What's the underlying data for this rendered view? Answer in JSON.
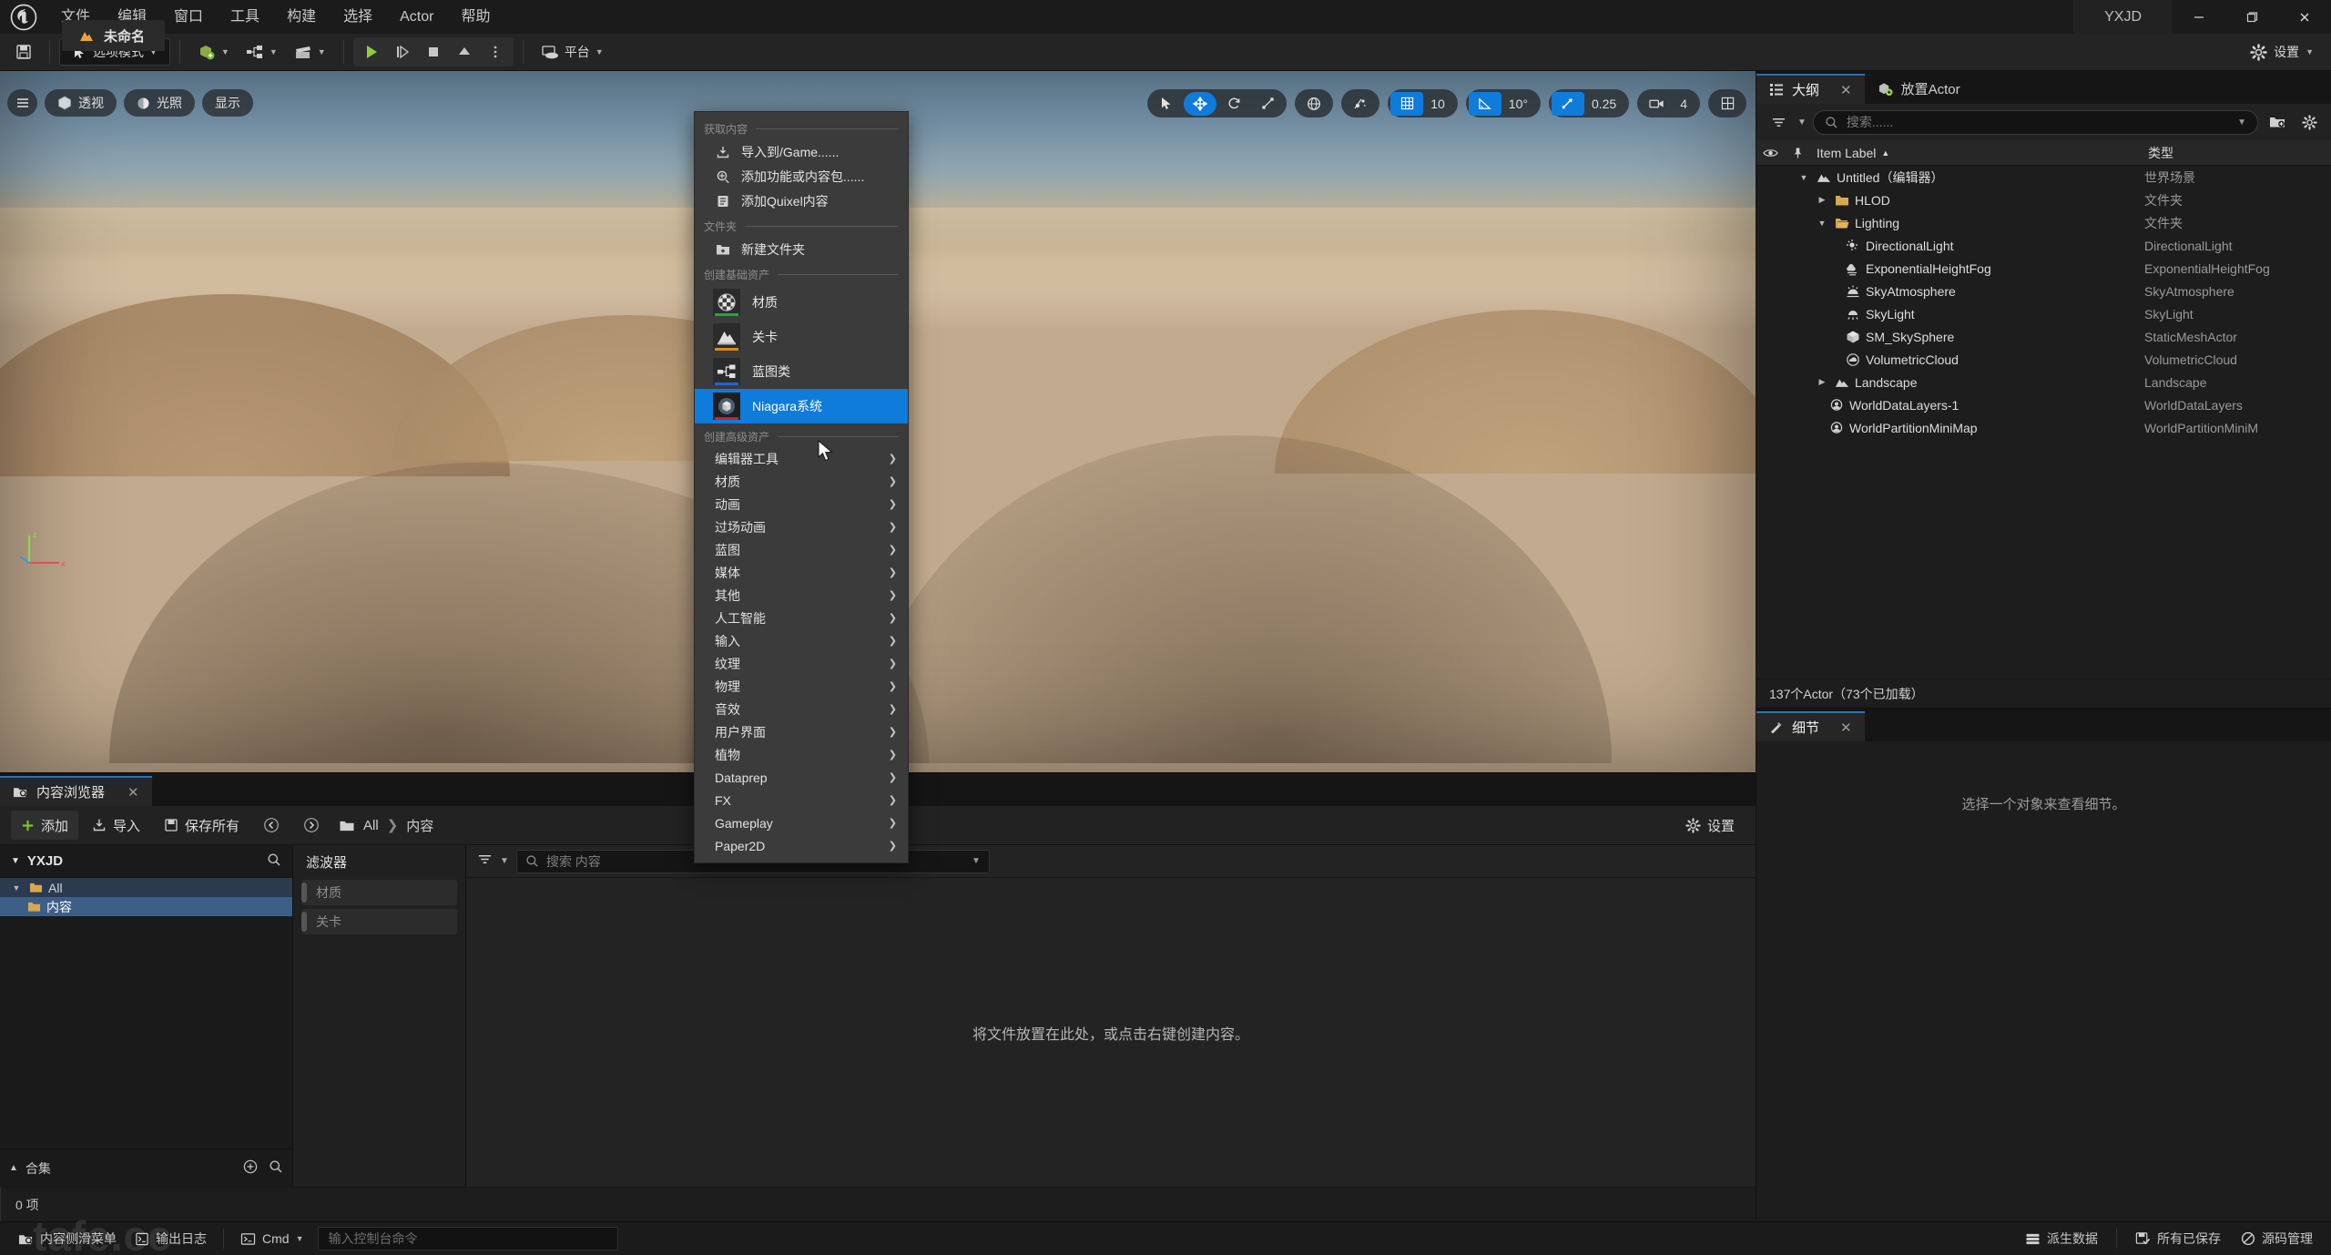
{
  "titlebar": {
    "menu_items": [
      "文件",
      "编辑",
      "窗口",
      "工具",
      "构建",
      "选择",
      "Actor",
      "帮助"
    ],
    "project_tab": "未命名",
    "window_title": "YXJD",
    "minimize": "—",
    "maximize": "❐",
    "close": "✕"
  },
  "toolbar": {
    "save_tip": "保存",
    "mode_label": "选项模式",
    "platform_label": "平台",
    "settings_label": "设置"
  },
  "viewport": {
    "menu_icon": "☰",
    "perspective": "透视",
    "lighting": "光照",
    "show": "显示",
    "grid_snap_value": "10",
    "angle_snap_value": "10°",
    "scale_snap_value": "0.25",
    "camera_speed_value": "4"
  },
  "context_menu": {
    "section_get_content": "获取内容",
    "section_folder": "文件夹",
    "section_basic_assets": "创建基础资产",
    "section_advanced_assets": "创建高级资产",
    "get_content_items": [
      {
        "label": "导入到/Game......",
        "icon": "import-icon"
      },
      {
        "label": "添加功能或内容包......",
        "icon": "add-feature-icon"
      },
      {
        "label": "添加Quixel内容",
        "icon": "quixel-icon"
      }
    ],
    "folder_items": [
      {
        "label": "新建文件夹",
        "icon": "new-folder-icon"
      }
    ],
    "basic_assets": [
      {
        "label": "材质",
        "icon": "material-icon",
        "accent": "#1faa34"
      },
      {
        "label": "关卡",
        "icon": "level-icon",
        "accent": "#d98c11"
      },
      {
        "label": "蓝图类",
        "icon": "blueprint-icon",
        "accent": "#1f62d8"
      },
      {
        "label": "Niagara系统",
        "icon": "niagara-icon",
        "accent": "#cf2020",
        "selected": true
      }
    ],
    "advanced_submenus": [
      "编辑器工具",
      "材质",
      "动画",
      "过场动画",
      "蓝图",
      "媒体",
      "其他",
      "人工智能",
      "输入",
      "纹理",
      "物理",
      "音效",
      "用户界面",
      "植物",
      "Dataprep",
      "FX",
      "Gameplay",
      "Paper2D"
    ],
    "highlight_color": "#0f7bdb"
  },
  "outliner": {
    "tab_outliner": "大纲",
    "tab_place_actor": "放置Actor",
    "search_placeholder": "搜索......",
    "col_item_label": "Item Label",
    "col_type": "类型",
    "sort_arrow": "▲",
    "rows": [
      {
        "label": "Untitled（编辑器）",
        "type": "世界场景",
        "indent": 1,
        "twisty": "▼",
        "icon": "world-icon"
      },
      {
        "label": "HLOD",
        "type": "文件夹",
        "indent": 2,
        "twisty": "▶",
        "icon": "folder-icon"
      },
      {
        "label": "Lighting",
        "type": "文件夹",
        "indent": 2,
        "twisty": "▼",
        "icon": "folder-open-icon"
      },
      {
        "label": "DirectionalLight",
        "type": "DirectionalLight",
        "indent": 3,
        "twisty": "",
        "icon": "directional-light-icon"
      },
      {
        "label": "ExponentialHeightFog",
        "type": "ExponentialHeightFog",
        "indent": 3,
        "twisty": "",
        "icon": "fog-icon"
      },
      {
        "label": "SkyAtmosphere",
        "type": "SkyAtmosphere",
        "indent": 3,
        "twisty": "",
        "icon": "sky-atmosphere-icon"
      },
      {
        "label": "SkyLight",
        "type": "SkyLight",
        "indent": 3,
        "twisty": "",
        "icon": "sky-light-icon"
      },
      {
        "label": "SM_SkySphere",
        "type": "StaticMeshActor",
        "indent": 3,
        "twisty": "",
        "icon": "static-mesh-icon"
      },
      {
        "label": "VolumetricCloud",
        "type": "VolumetricCloud",
        "indent": 3,
        "twisty": "",
        "icon": "cloud-icon"
      },
      {
        "label": "Landscape",
        "type": "Landscape",
        "indent": 2,
        "twisty": "▶",
        "icon": "landscape-icon"
      },
      {
        "label": "WorldDataLayers-1",
        "type": "WorldDataLayers",
        "indent": 2,
        "twisty": "",
        "icon": "data-layer-icon"
      },
      {
        "label": "WorldPartitionMiniMap",
        "type": "WorldPartitionMiniM",
        "indent": 2,
        "twisty": "",
        "icon": "minimap-icon"
      }
    ],
    "footer": "137个Actor（73个已加载）"
  },
  "details": {
    "tab_label": "细节",
    "empty_text": "选择一个对象来查看细节。"
  },
  "content_browser": {
    "tab_label": "内容浏览器",
    "add_label": "添加",
    "import_label": "导入",
    "save_all_label": "保存所有",
    "breadcrumb_all": "All",
    "breadcrumb_content": "内容",
    "settings_label": "设置",
    "tree_root": "YXJD",
    "tree_nodes": [
      {
        "label": "All",
        "level": 1,
        "twisty": "▼",
        "state": "hl"
      },
      {
        "label": "内容",
        "level": 2,
        "twisty": "",
        "state": "sel"
      }
    ],
    "tree_footer": "合集",
    "filter_title": "滤波器",
    "filters": [
      "材质",
      "关卡"
    ],
    "search_placeholder": "搜索 内容",
    "empty_message": "将文件放置在此处，或点击右键创建内容。",
    "item_count": "0 项"
  },
  "statusbar": {
    "content_drawer": "内容侧滑菜单",
    "output_log": "输出日志",
    "cmd_label": "Cmd",
    "cmd_placeholder": "输入控制台命令",
    "derived_data": "派生数据",
    "all_saved": "所有已保存",
    "source_control": "源码管理"
  },
  "watermark": "tafe.cc"
}
